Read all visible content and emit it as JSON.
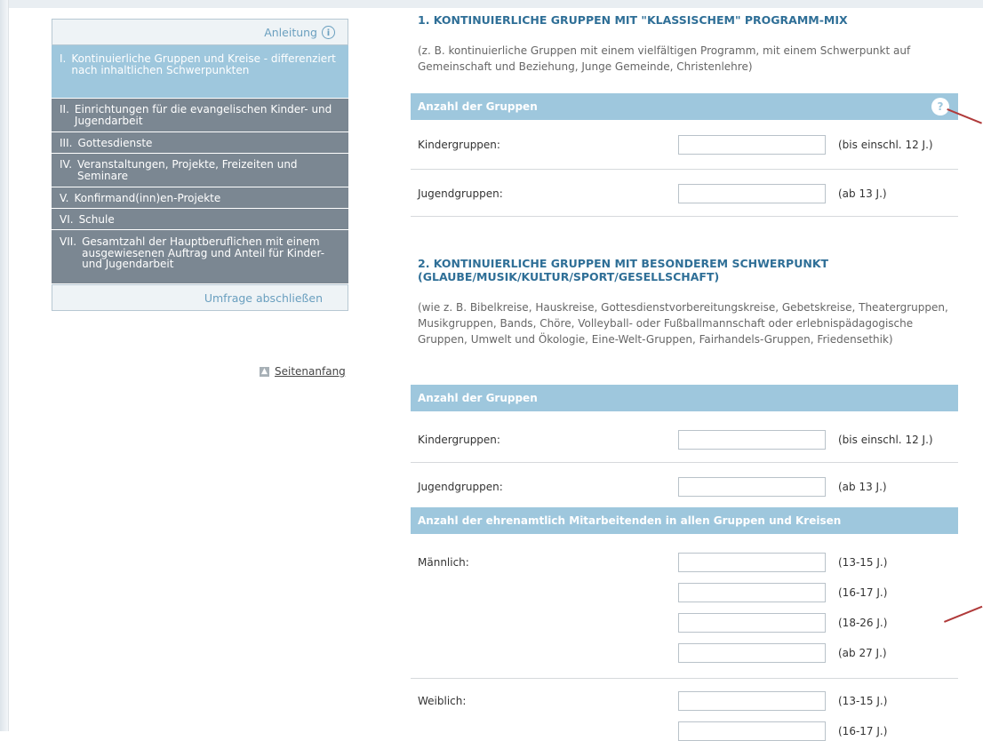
{
  "sidebar": {
    "guide_label": "Anleitung",
    "items": [
      {
        "num": "I.",
        "label": "Kontinuierliche Gruppen und Kreise - differenziert nach inhaltlichen Schwerpunkten"
      },
      {
        "num": "II.",
        "label": "Einrichtungen für die evangelischen Kinder- und Jugendarbeit"
      },
      {
        "num": "III.",
        "label": "Gottesdienste"
      },
      {
        "num": "IV.",
        "label": "Veranstaltungen, Projekte, Freizeiten und Seminare"
      },
      {
        "num": "V.",
        "label": "Konfirmand(inn)en-Projekte"
      },
      {
        "num": "VI.",
        "label": "Schule"
      },
      {
        "num": "VII.",
        "label": "Gesamtzahl der Hauptberuflichen mit einem ausgewiesenen Auftrag und Anteil für Kinder- und Jugendarbeit"
      }
    ],
    "finish_label": "Umfrage abschließen",
    "top_link": "Seitenanfang"
  },
  "section1": {
    "title": "1. KONTINUIERLICHE GRUPPEN MIT \"KLASSISCHEM\" PROGRAMM-MIX",
    "desc": "(z. B. kontinuierliche Gruppen mit einem vielfältigen Programm, mit einem Schwerpunkt auf Gemeinschaft und Beziehung, Junge Gemeinde, Christenlehre)",
    "bar": "Anzahl der Gruppen",
    "help": "?",
    "rows": [
      {
        "label": "Kindergruppen:",
        "value": "",
        "note": "(bis einschl. 12 J.)"
      },
      {
        "label": "Jugendgruppen:",
        "value": "",
        "note": "(ab 13 J.)"
      }
    ]
  },
  "section2": {
    "title": "2. KONTINUIERLICHE GRUPPEN MIT BESONDEREM SCHWERPUNKT (GLAUBE/MUSIK/KULTUR/SPORT/GESELLSCHAFT)",
    "desc": "(wie z. B. Bibelkreise, Hauskreise, Gottesdienstvorbereitungskreise, Gebetskreise, Theatergruppen, Musikgruppen, Bands, Chöre, Volleyball- oder Fußballmannschaft oder erlebnispädagogische Gruppen, Umwelt und Ökologie, Eine-Welt-Gruppen, Fairhandels-Gruppen, Friedensethik)",
    "bar": "Anzahl der Gruppen",
    "rows": [
      {
        "label": "Kindergruppen:",
        "value": "",
        "note": "(bis einschl. 12 J.)"
      },
      {
        "label": "Jugendgruppen:",
        "value": "",
        "note": "(ab 13 J.)"
      }
    ],
    "bar2": "Anzahl der ehrenamtlich Mitarbeitenden in allen Gruppen und Kreisen",
    "male_label": "Männlich:",
    "male_ages": [
      "(13-15 J.)",
      "(16-17 J.)",
      "(18-26 J.)",
      "(ab 27 J.)"
    ],
    "female_label": "Weiblich:",
    "female_ages": [
      "(13-15 J.)",
      "(16-17 J.)"
    ]
  }
}
